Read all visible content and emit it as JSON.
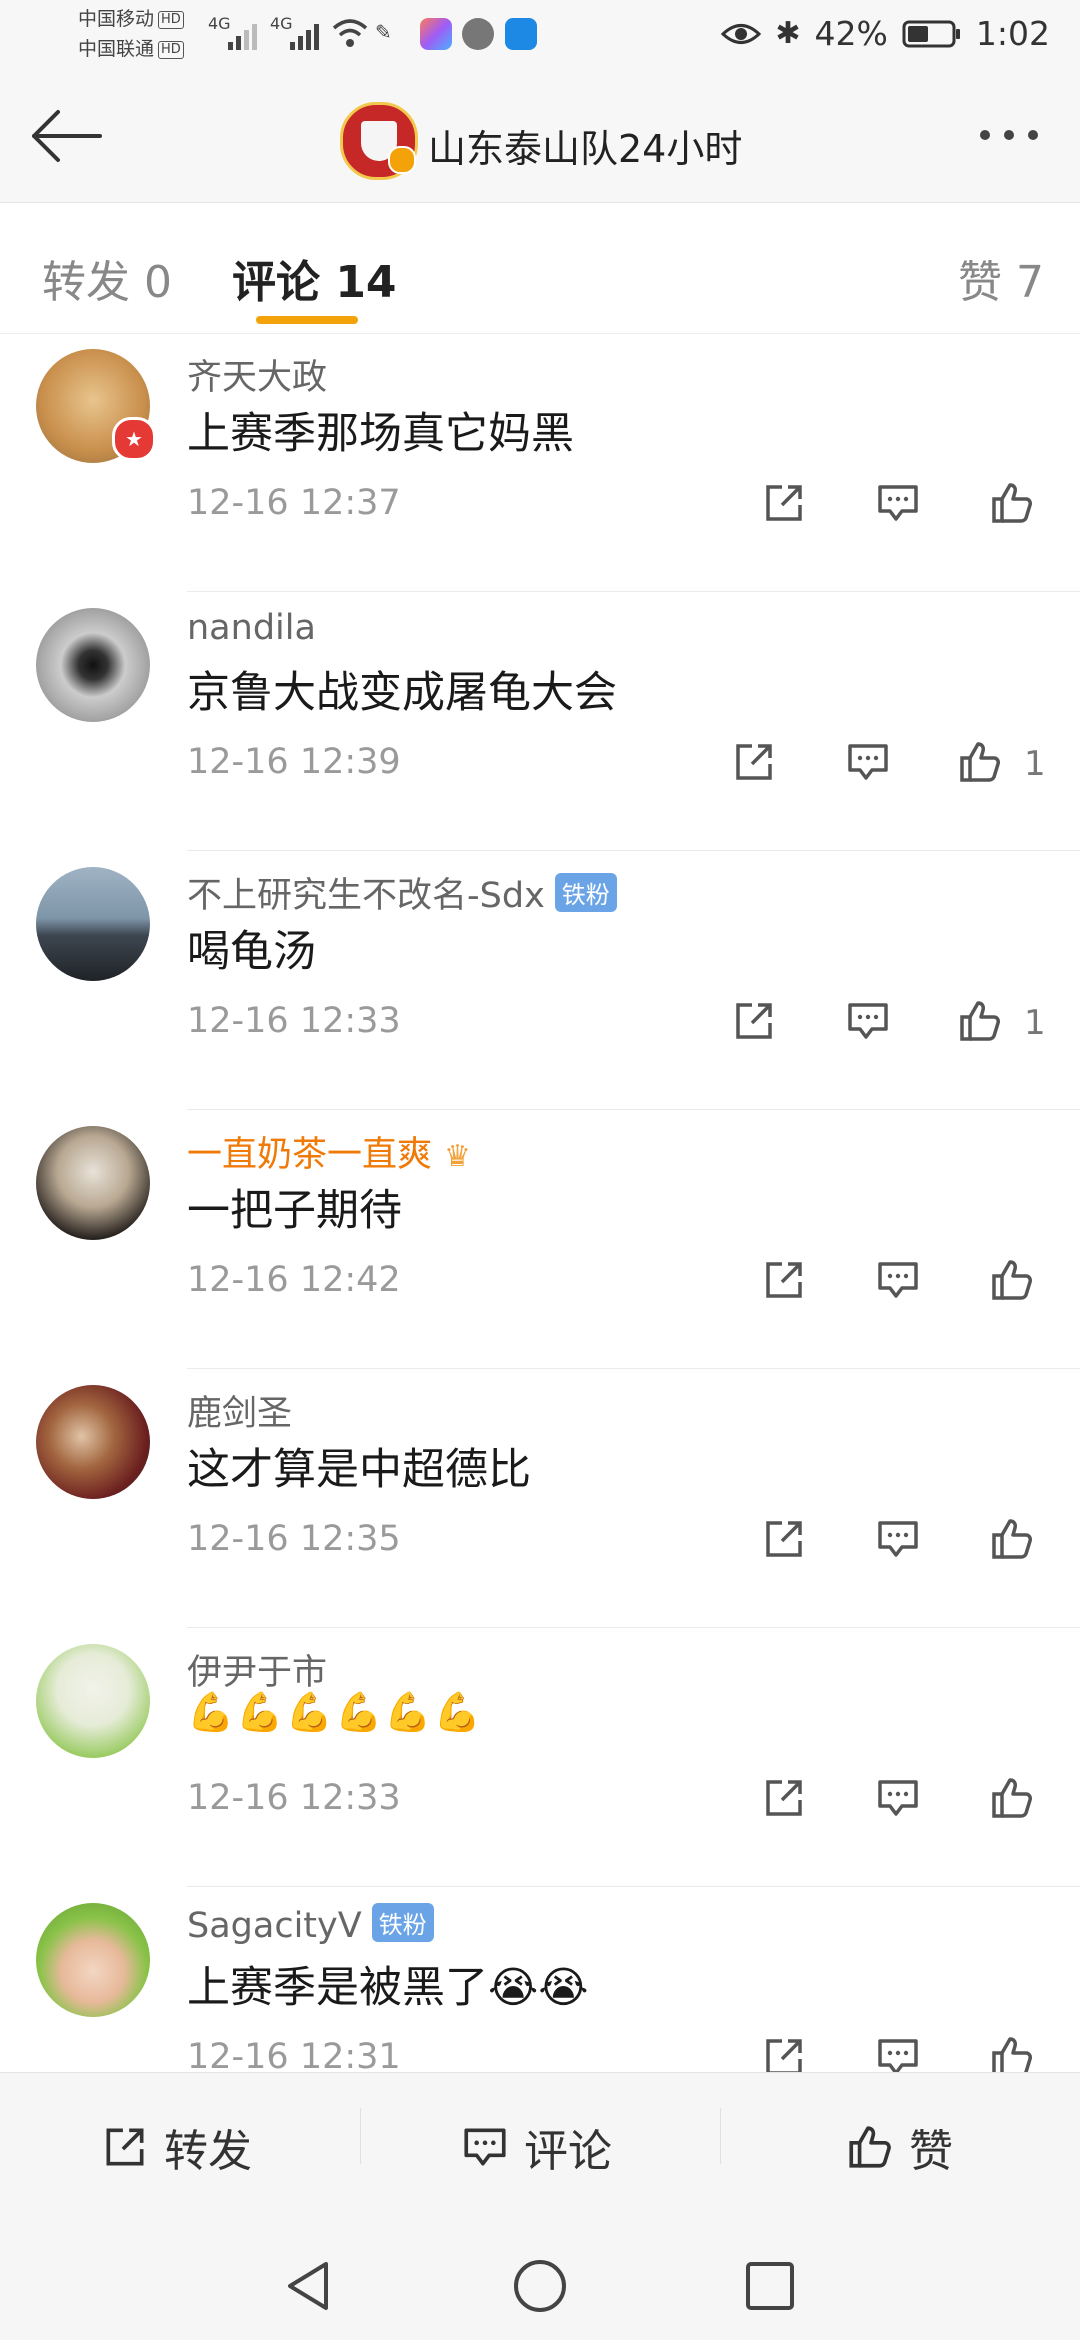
{
  "status": {
    "carrier1": "中国移动",
    "carrier2": "中国联通",
    "hd": "HD",
    "net1": "4G",
    "net2": "4G",
    "battery": "42%",
    "time": "1:02"
  },
  "header": {
    "title": "山东泰山队24小时"
  },
  "tabs": {
    "repost": "转发 0",
    "comment": "评论 14",
    "like": "赞 7"
  },
  "comments": [
    {
      "user": "齐天大政",
      "text": "上赛季那场真它妈黑",
      "time": "12-16 12:37",
      "likes": ""
    },
    {
      "user": "nandila",
      "text": "京鲁大战变成屠龟大会",
      "time": "12-16 12:39",
      "likes": "1"
    },
    {
      "user": "不上研究生不改名-Sdx",
      "badge": "铁粉",
      "text": "喝龟汤",
      "time": "12-16 12:33",
      "likes": "1"
    },
    {
      "user": "一直奶茶一直爽",
      "text": "一把子期待",
      "time": "12-16 12:42",
      "likes": ""
    },
    {
      "user": "鹿剑圣",
      "text": "这才算是中超德比",
      "time": "12-16 12:35",
      "likes": ""
    },
    {
      "user": "伊尹于市",
      "text": "💪💪💪💪💪💪",
      "time": "12-16 12:33",
      "likes": ""
    },
    {
      "user": "SagacityV",
      "badge": "铁粉",
      "text": "上赛季是被黑了😭😭",
      "time": "12-16 12:31",
      "likes": ""
    }
  ],
  "bottom": {
    "repost": "转发",
    "comment": "评论",
    "like": "赞"
  },
  "colors": {
    "accent": "#f4a20a",
    "vip": "#f07a08",
    "badge": "#6aa4e6"
  }
}
